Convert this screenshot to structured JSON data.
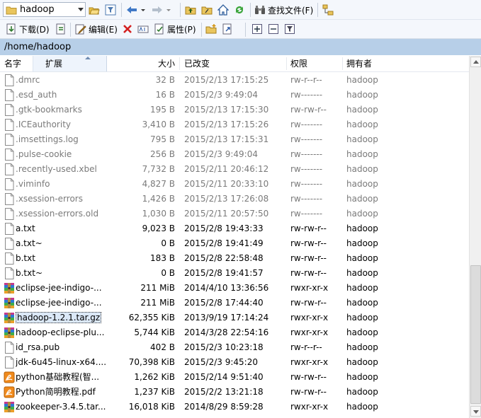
{
  "toolbar1": {
    "folder_combo": "hadoop",
    "find_files_label": "查找文件(F)"
  },
  "toolbar2": {
    "download_label": "下载(D)",
    "edit_label": "编辑(E)",
    "properties_label": "属性(P)"
  },
  "path": "/home/hadoop",
  "columns": {
    "name": "名字",
    "ext": "扩展",
    "size": "大小",
    "modified": "已改变",
    "perms": "权限",
    "owner": "拥有者"
  },
  "colors": {
    "toolbar_bg": "#f4f7fc",
    "path_bar_bg": "#b7cfe8",
    "hidden_text": "#7a7a7a"
  },
  "files": [
    {
      "name": ".dmrc",
      "size": "32 B",
      "modified": "2015/2/13 17:15:25",
      "perms": "rw-r--r--",
      "owner": "hadoop",
      "icon": "file-icon",
      "hidden": true
    },
    {
      "name": ".esd_auth",
      "size": "16 B",
      "modified": "2015/2/3 9:49:04",
      "perms": "rw-------",
      "owner": "hadoop",
      "icon": "file-icon",
      "hidden": true
    },
    {
      "name": ".gtk-bookmarks",
      "size": "195 B",
      "modified": "2015/2/13 17:15:30",
      "perms": "rw-rw-r--",
      "owner": "hadoop",
      "icon": "file-icon",
      "hidden": true
    },
    {
      "name": ".ICEauthority",
      "size": "3,410 B",
      "modified": "2015/2/13 17:15:26",
      "perms": "rw-------",
      "owner": "hadoop",
      "icon": "file-icon",
      "hidden": true
    },
    {
      "name": ".imsettings.log",
      "size": "795 B",
      "modified": "2015/2/13 17:15:31",
      "perms": "rw-------",
      "owner": "hadoop",
      "icon": "file-icon",
      "hidden": true
    },
    {
      "name": ".pulse-cookie",
      "size": "256 B",
      "modified": "2015/2/3 9:49:04",
      "perms": "rw-------",
      "owner": "hadoop",
      "icon": "file-icon",
      "hidden": true
    },
    {
      "name": ".recently-used.xbel",
      "size": "7,732 B",
      "modified": "2015/2/11 20:46:12",
      "perms": "rw-------",
      "owner": "hadoop",
      "icon": "file-icon",
      "hidden": true
    },
    {
      "name": ".viminfo",
      "size": "4,827 B",
      "modified": "2015/2/11 20:33:10",
      "perms": "rw-------",
      "owner": "hadoop",
      "icon": "file-icon",
      "hidden": true
    },
    {
      "name": ".xsession-errors",
      "size": "1,426 B",
      "modified": "2015/2/13 17:26:08",
      "perms": "rw-------",
      "owner": "hadoop",
      "icon": "file-icon",
      "hidden": true
    },
    {
      "name": ".xsession-errors.old",
      "size": "1,030 B",
      "modified": "2015/2/11 20:57:50",
      "perms": "rw-------",
      "owner": "hadoop",
      "icon": "file-icon",
      "hidden": true
    },
    {
      "name": "a.txt",
      "size": "9,023 B",
      "modified": "2015/2/8 19:43:33",
      "perms": "rw-rw-r--",
      "owner": "hadoop",
      "icon": "file-icon",
      "hidden": false
    },
    {
      "name": "a.txt~",
      "size": "0 B",
      "modified": "2015/2/8 19:41:49",
      "perms": "rw-rw-r--",
      "owner": "hadoop",
      "icon": "file-icon",
      "hidden": false
    },
    {
      "name": "b.txt",
      "size": "183 B",
      "modified": "2015/2/8 22:58:48",
      "perms": "rw-rw-r--",
      "owner": "hadoop",
      "icon": "file-icon",
      "hidden": false
    },
    {
      "name": "b.txt~",
      "size": "0 B",
      "modified": "2015/2/8 19:41:57",
      "perms": "rw-rw-r--",
      "owner": "hadoop",
      "icon": "file-icon",
      "hidden": false
    },
    {
      "name": "eclipse-jee-indigo-...",
      "size": "211 MiB",
      "modified": "2014/4/10 13:36:56",
      "perms": "rwxr-xr-x",
      "owner": "hadoop",
      "icon": "archive-icon",
      "hidden": false
    },
    {
      "name": "eclipse-jee-indigo-...",
      "size": "211 MiB",
      "modified": "2015/2/8 17:44:40",
      "perms": "rw-rw-r--",
      "owner": "hadoop",
      "icon": "archive-icon",
      "hidden": false
    },
    {
      "name": "hadoop-1.2.1.tar.gz",
      "size": "62,355 KiB",
      "modified": "2013/9/19 17:14:24",
      "perms": "rwxr-xr-x",
      "owner": "hadoop",
      "icon": "archive-icon",
      "hidden": false,
      "selected": true
    },
    {
      "name": "hadoop-eclipse-plu...",
      "size": "5,744 KiB",
      "modified": "2014/3/28 22:54:16",
      "perms": "rwxr-xr-x",
      "owner": "hadoop",
      "icon": "archive-icon",
      "hidden": false
    },
    {
      "name": "id_rsa.pub",
      "size": "402 B",
      "modified": "2015/2/3 10:23:18",
      "perms": "rw-r--r--",
      "owner": "hadoop",
      "icon": "file-icon",
      "hidden": false
    },
    {
      "name": "jdk-6u45-linux-x64....",
      "size": "70,398 KiB",
      "modified": "2015/2/3 9:45:20",
      "perms": "rwxr-xr-x",
      "owner": "hadoop",
      "icon": "file-icon",
      "hidden": false
    },
    {
      "name": "python基础教程(智...",
      "size": "1,262 KiB",
      "modified": "2015/2/14 9:51:40",
      "perms": "rw-rw-r--",
      "owner": "hadoop",
      "icon": "pdf-icon",
      "hidden": false
    },
    {
      "name": "Python简明教程.pdf",
      "size": "1,237 KiB",
      "modified": "2015/2/2 13:21:18",
      "perms": "rw-rw-r--",
      "owner": "hadoop",
      "icon": "pdf-icon",
      "hidden": false
    },
    {
      "name": "zookeeper-3.4.5.tar...",
      "size": "16,018 KiB",
      "modified": "2014/8/29 8:59:28",
      "perms": "rwxr-xr-x",
      "owner": "hadoop",
      "icon": "archive-icon",
      "hidden": false
    }
  ]
}
